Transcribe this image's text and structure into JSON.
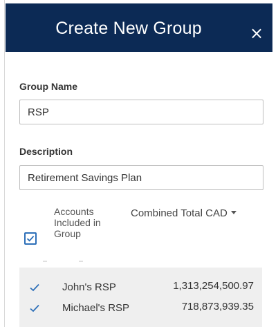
{
  "dialog": {
    "title": "Create New Group",
    "close_glyph": "×"
  },
  "group_name": {
    "label": "Group Name",
    "value": "RSP"
  },
  "description": {
    "label": "Description",
    "value": "Retirement Savings Plan"
  },
  "accounts": {
    "header": "Accounts Included in Group",
    "total_header": "Combined Total CAD",
    "select_all_checked": true,
    "rows": [
      {
        "name": "John's RSP",
        "amount": "1,313,254,500.97",
        "checked": true
      },
      {
        "name": "Michael's RSP",
        "amount": "718,873,939.35",
        "checked": true
      }
    ]
  },
  "colors": {
    "header_bg": "#0c2a55",
    "accent": "#2d6fb8",
    "rows_bg": "#efefef"
  },
  "icons": {
    "close": "close-icon",
    "check": "checkmark-icon",
    "dropdown": "caret-down-icon"
  }
}
